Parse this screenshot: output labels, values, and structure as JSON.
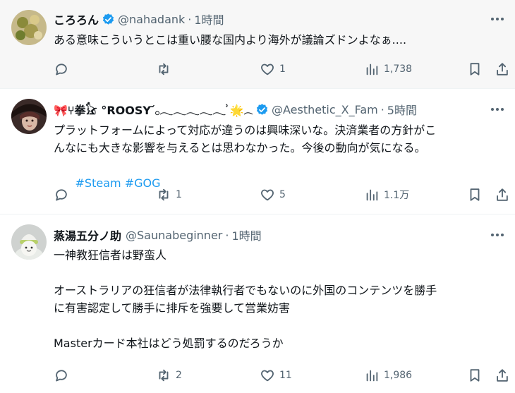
{
  "tweets": [
    {
      "name": "ころろん",
      "handle": "@nahadank",
      "time": "1時間",
      "verified": true,
      "lines": [
        "ある意味こういうとこは重い腰な国内より海外が議論ズドンよなぁ...."
      ],
      "hashtags": [],
      "replies": "",
      "retweets": "",
      "likes": "1",
      "views": "1,738"
    },
    {
      "name": "🎀⑂拳𓃠 °ROOSY ᷄𓂂𓂃𓂃𓂃𓂃𓂃 ͗🌟𓂃𓂃𝕏",
      "handle": "@Aesthetic_X_Fam",
      "time": "5時間",
      "verified": true,
      "lines": [
        "プラットフォームによって対応が違うのは興味深いな。決済業者の方針がこ",
        "んなにも大きな影響を与えるとは思わなかった。今後の動向が気になる。"
      ],
      "hashtags": [
        "#Steam",
        "#GOG"
      ],
      "replies": "",
      "retweets": "1",
      "likes": "5",
      "views": "1.1万"
    },
    {
      "name": "蒸湯五分ノ助",
      "handle": "@Saunabeginner",
      "time": "1時間",
      "verified": false,
      "lines": [
        "一神教狂信者は野蛮人",
        "",
        "オーストラリアの狂信者が法律執行者でもないのに外国のコンテンツを勝手",
        "に有害認定して勝手に排斥を強要して営業妨害",
        "",
        "Masterカード本社はどう処罰するのだろうか"
      ],
      "hashtags": [],
      "replies": "",
      "retweets": "2",
      "likes": "11",
      "views": "1,986"
    }
  ],
  "separator": "·",
  "colors": {
    "accent": "#1d9bf0",
    "muted": "#536471",
    "text": "#0f1419"
  }
}
